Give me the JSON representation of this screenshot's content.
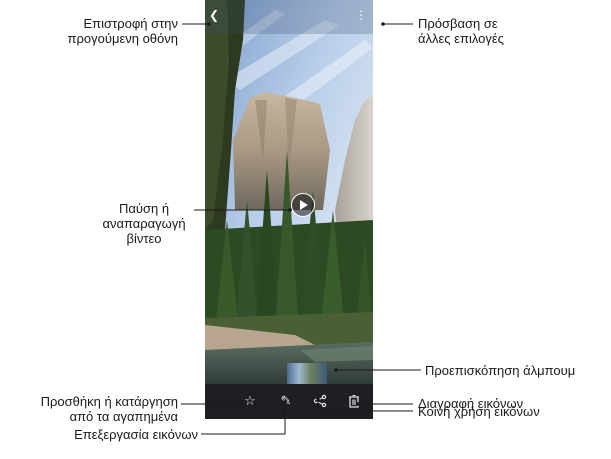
{
  "callouts": {
    "back": "Επιστροφή στην\nπρογούμενη οθόνη",
    "more_options": "Πρόσβαση σε\nάλλες επιλογές",
    "play_pause": "Παύση ή\nαναπαραγωγή\nβίντεο",
    "album_preview": "Προεπισκόπηση άλμπουμ",
    "favorite": "Προσθήκη ή κατάργηση\nαπό τα αγαπημένα",
    "delete": "Διαγραφή εικόνων",
    "share": "Κοινή χρήση εικόνων",
    "edit": "Επεξεργασία εικόνων"
  },
  "icons": {
    "back": "back-arrow-icon",
    "more": "more-options-icon",
    "play": "play-icon",
    "favorite": "star-icon",
    "edit": "pencil-icon",
    "share": "share-icon",
    "delete": "trash-icon"
  },
  "colors": {
    "bottom_bar": "#1d1f22",
    "callout_line": "#1a1a1a"
  }
}
